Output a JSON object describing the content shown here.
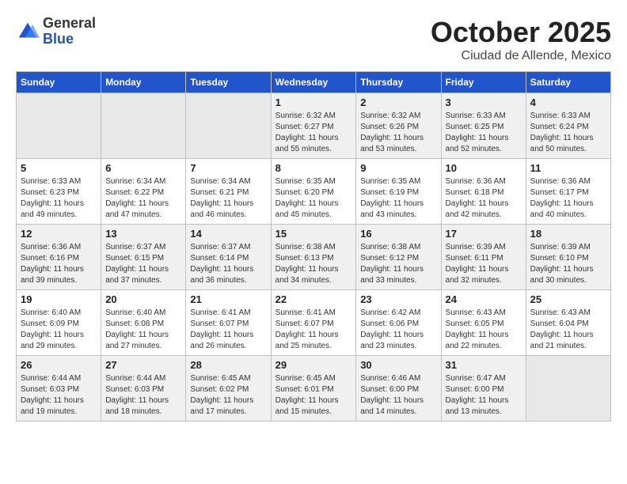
{
  "logo": {
    "general": "General",
    "blue": "Blue"
  },
  "title": "October 2025",
  "subtitle": "Ciudad de Allende, Mexico",
  "weekdays": [
    "Sunday",
    "Monday",
    "Tuesday",
    "Wednesday",
    "Thursday",
    "Friday",
    "Saturday"
  ],
  "weeks": [
    [
      {
        "day": "",
        "info": ""
      },
      {
        "day": "",
        "info": ""
      },
      {
        "day": "",
        "info": ""
      },
      {
        "day": "1",
        "info": "Sunrise: 6:32 AM\nSunset: 6:27 PM\nDaylight: 11 hours and 55 minutes."
      },
      {
        "day": "2",
        "info": "Sunrise: 6:32 AM\nSunset: 6:26 PM\nDaylight: 11 hours and 53 minutes."
      },
      {
        "day": "3",
        "info": "Sunrise: 6:33 AM\nSunset: 6:25 PM\nDaylight: 11 hours and 52 minutes."
      },
      {
        "day": "4",
        "info": "Sunrise: 6:33 AM\nSunset: 6:24 PM\nDaylight: 11 hours and 50 minutes."
      }
    ],
    [
      {
        "day": "5",
        "info": "Sunrise: 6:33 AM\nSunset: 6:23 PM\nDaylight: 11 hours and 49 minutes."
      },
      {
        "day": "6",
        "info": "Sunrise: 6:34 AM\nSunset: 6:22 PM\nDaylight: 11 hours and 47 minutes."
      },
      {
        "day": "7",
        "info": "Sunrise: 6:34 AM\nSunset: 6:21 PM\nDaylight: 11 hours and 46 minutes."
      },
      {
        "day": "8",
        "info": "Sunrise: 6:35 AM\nSunset: 6:20 PM\nDaylight: 11 hours and 45 minutes."
      },
      {
        "day": "9",
        "info": "Sunrise: 6:35 AM\nSunset: 6:19 PM\nDaylight: 11 hours and 43 minutes."
      },
      {
        "day": "10",
        "info": "Sunrise: 6:36 AM\nSunset: 6:18 PM\nDaylight: 11 hours and 42 minutes."
      },
      {
        "day": "11",
        "info": "Sunrise: 6:36 AM\nSunset: 6:17 PM\nDaylight: 11 hours and 40 minutes."
      }
    ],
    [
      {
        "day": "12",
        "info": "Sunrise: 6:36 AM\nSunset: 6:16 PM\nDaylight: 11 hours and 39 minutes."
      },
      {
        "day": "13",
        "info": "Sunrise: 6:37 AM\nSunset: 6:15 PM\nDaylight: 11 hours and 37 minutes."
      },
      {
        "day": "14",
        "info": "Sunrise: 6:37 AM\nSunset: 6:14 PM\nDaylight: 11 hours and 36 minutes."
      },
      {
        "day": "15",
        "info": "Sunrise: 6:38 AM\nSunset: 6:13 PM\nDaylight: 11 hours and 34 minutes."
      },
      {
        "day": "16",
        "info": "Sunrise: 6:38 AM\nSunset: 6:12 PM\nDaylight: 11 hours and 33 minutes."
      },
      {
        "day": "17",
        "info": "Sunrise: 6:39 AM\nSunset: 6:11 PM\nDaylight: 11 hours and 32 minutes."
      },
      {
        "day": "18",
        "info": "Sunrise: 6:39 AM\nSunset: 6:10 PM\nDaylight: 11 hours and 30 minutes."
      }
    ],
    [
      {
        "day": "19",
        "info": "Sunrise: 6:40 AM\nSunset: 6:09 PM\nDaylight: 11 hours and 29 minutes."
      },
      {
        "day": "20",
        "info": "Sunrise: 6:40 AM\nSunset: 6:08 PM\nDaylight: 11 hours and 27 minutes."
      },
      {
        "day": "21",
        "info": "Sunrise: 6:41 AM\nSunset: 6:07 PM\nDaylight: 11 hours and 26 minutes."
      },
      {
        "day": "22",
        "info": "Sunrise: 6:41 AM\nSunset: 6:07 PM\nDaylight: 11 hours and 25 minutes."
      },
      {
        "day": "23",
        "info": "Sunrise: 6:42 AM\nSunset: 6:06 PM\nDaylight: 11 hours and 23 minutes."
      },
      {
        "day": "24",
        "info": "Sunrise: 6:43 AM\nSunset: 6:05 PM\nDaylight: 11 hours and 22 minutes."
      },
      {
        "day": "25",
        "info": "Sunrise: 6:43 AM\nSunset: 6:04 PM\nDaylight: 11 hours and 21 minutes."
      }
    ],
    [
      {
        "day": "26",
        "info": "Sunrise: 6:44 AM\nSunset: 6:03 PM\nDaylight: 11 hours and 19 minutes."
      },
      {
        "day": "27",
        "info": "Sunrise: 6:44 AM\nSunset: 6:03 PM\nDaylight: 11 hours and 18 minutes."
      },
      {
        "day": "28",
        "info": "Sunrise: 6:45 AM\nSunset: 6:02 PM\nDaylight: 11 hours and 17 minutes."
      },
      {
        "day": "29",
        "info": "Sunrise: 6:45 AM\nSunset: 6:01 PM\nDaylight: 11 hours and 15 minutes."
      },
      {
        "day": "30",
        "info": "Sunrise: 6:46 AM\nSunset: 6:00 PM\nDaylight: 11 hours and 14 minutes."
      },
      {
        "day": "31",
        "info": "Sunrise: 6:47 AM\nSunset: 6:00 PM\nDaylight: 11 hours and 13 minutes."
      },
      {
        "day": "",
        "info": ""
      }
    ]
  ]
}
